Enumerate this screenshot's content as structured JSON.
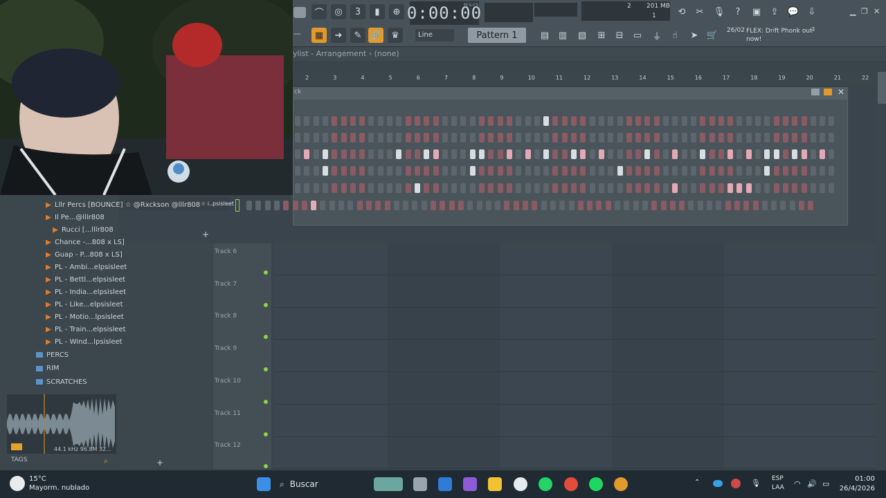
{
  "toolbar": {
    "time": "0:00:00",
    "time_mode": "M:S:CS",
    "cpu_value": "2",
    "memory": "201 MB",
    "polyphony": "1",
    "pattern_label": "Pattern 1",
    "snap_mode": "Line",
    "news_date": "26/02",
    "news_text": "FLEX: Drift Phonk out now!",
    "news_badge": "3"
  },
  "playlist": {
    "title": "ylist - Arrangement › (none)",
    "ruler": [
      "2",
      "3",
      "4",
      "5",
      "6",
      "7",
      "8",
      "9",
      "10",
      "11",
      "12",
      "13",
      "14",
      "15",
      "16",
      "17",
      "18",
      "19",
      "20",
      "21",
      "22"
    ],
    "tracks": [
      "Track 6",
      "Track 7",
      "Track 8",
      "Track 9",
      "Track 10",
      "Track 11",
      "Track 12"
    ]
  },
  "channel_rack": {
    "title": "ck"
  },
  "browser": {
    "hint_left": "Lllr Percs [BOUNCE] ☆ @Rxckson @lllr808",
    "hint_right": "☆ i..psisleet",
    "items": [
      "Lllr Percs [BOUNCE] ☆ @Rxckson @lllr808",
      "Il Pe...@lllr808",
      "Rucci [...lllr808",
      "Chance -...808 x LS]",
      "Guap - P...808 x LS]",
      "PL - Ambi...elpsisleet",
      "PL - Bettl...elpsisleet",
      "PL - India...elpsisleet",
      "PL - Like...elpsisleet",
      "PL - Motio...lpsisleet",
      "PL - Train...elpsisleet",
      "PL - Wind...lpsisleet"
    ],
    "folders": [
      "PERCS",
      "RIM",
      "SCRATCHES"
    ],
    "wave_info": "44.1 kHz 96.8M 32...",
    "tags_label": "TAGS"
  },
  "taskbar": {
    "weather_temp": "15°C",
    "weather_desc": "Mayorm. nublado",
    "search_label": "Buscar",
    "lang_1": "ESP",
    "lang_2": "LAA",
    "time": "01:00",
    "date": "26/4/2026"
  },
  "colors": {
    "accent": "#e39a2c",
    "track_dot": "#8fd342",
    "step_on_pink": "#e4a9b4",
    "step_on_white": "#d7dde2"
  }
}
